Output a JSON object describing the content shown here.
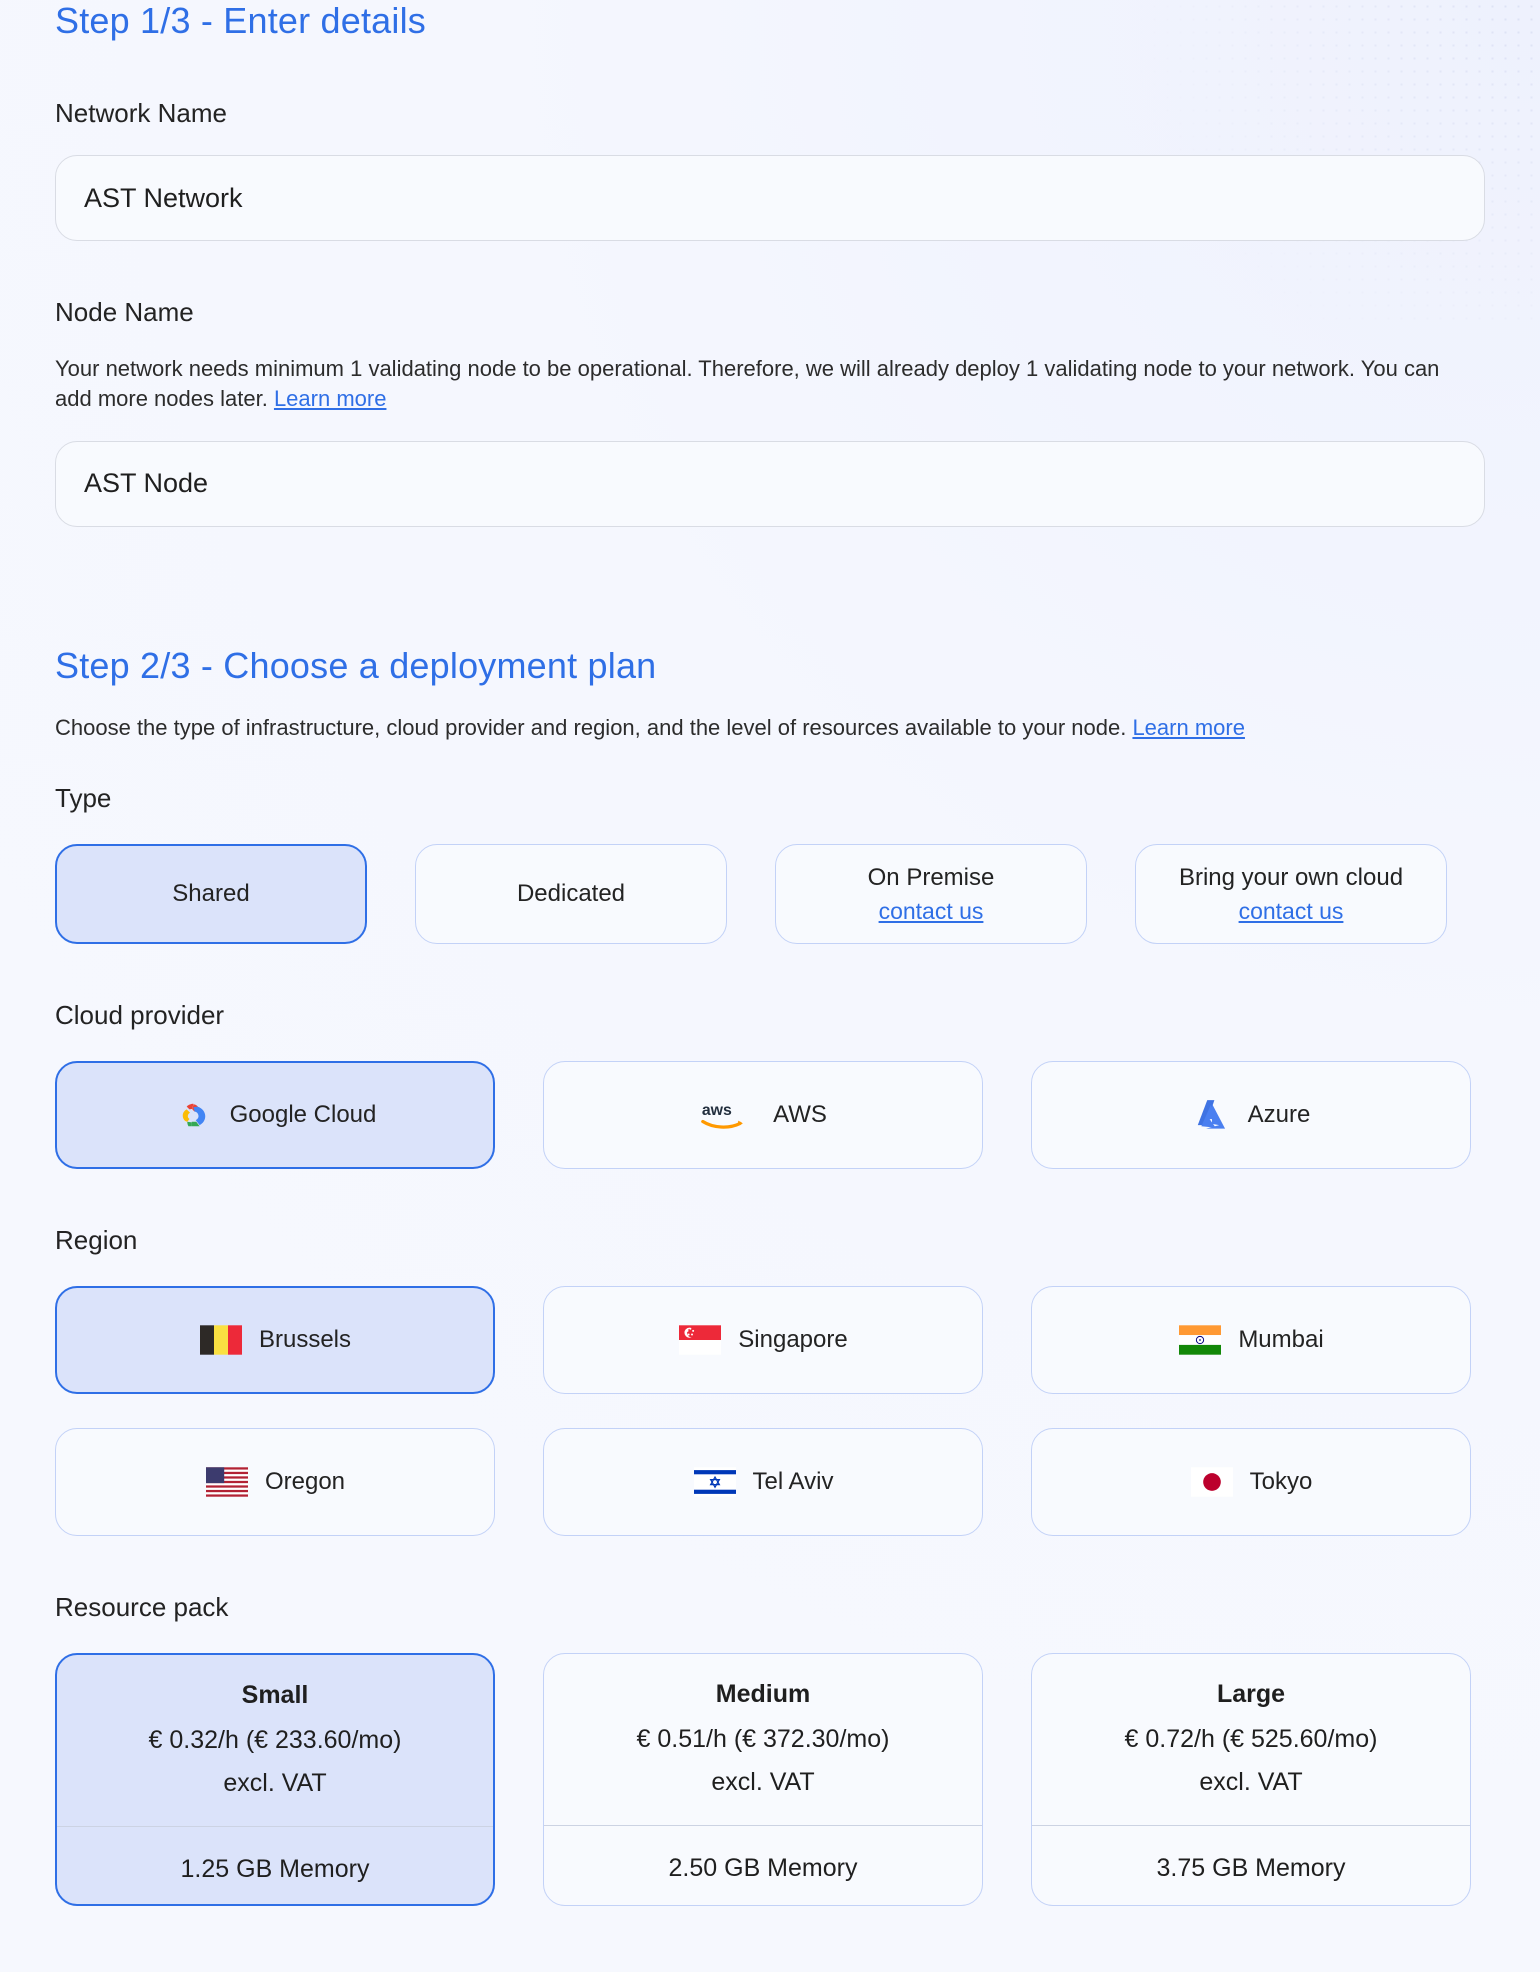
{
  "step1": {
    "title": "Step 1/3 - Enter details",
    "network_name_label": "Network Name",
    "network_name_value": "AST Network",
    "network_name_placeholder": "Network Name",
    "node_name_label": "Node Name",
    "node_helper": "Your network needs minimum 1 validating node to be operational. Therefore, we will already deploy 1 validating node to your network. You can add more nodes later.",
    "node_helper_link": "Learn more",
    "node_name_value": "AST Node",
    "node_name_placeholder": "Node Name"
  },
  "step2": {
    "title": "Step 2/3 - Choose a deployment plan",
    "description": "Choose the type of infrastructure, cloud provider and region, and the level of resources available to your node.",
    "description_link": "Learn more",
    "type_label": "Type",
    "types": [
      {
        "label": "Shared",
        "sub": "",
        "selected": true
      },
      {
        "label": "Dedicated",
        "sub": "",
        "selected": false
      },
      {
        "label": "On Premise",
        "sub": "contact us",
        "selected": false
      },
      {
        "label": "Bring your own cloud",
        "sub": "contact us",
        "selected": false
      }
    ],
    "cloud_provider_label": "Cloud provider",
    "providers": [
      {
        "label": "Google Cloud",
        "icon": "google-cloud-logo",
        "selected": true
      },
      {
        "label": "AWS",
        "icon": "aws-logo",
        "selected": false
      },
      {
        "label": "Azure",
        "icon": "azure-logo",
        "selected": false
      }
    ],
    "region_label": "Region",
    "regions": [
      {
        "label": "Brussels",
        "icon": "flag-belgium",
        "selected": true
      },
      {
        "label": "Singapore",
        "icon": "flag-singapore",
        "selected": false
      },
      {
        "label": "Mumbai",
        "icon": "flag-india",
        "selected": false
      },
      {
        "label": "Oregon",
        "icon": "flag-united-states",
        "selected": false
      },
      {
        "label": "Tel Aviv",
        "icon": "flag-israel",
        "selected": false
      },
      {
        "label": "Tokyo",
        "icon": "flag-japan",
        "selected": false
      }
    ],
    "resource_pack_label": "Resource pack",
    "packs": [
      {
        "name": "Small",
        "price": "€ 0.32/h (€ 233.60/mo)",
        "vat": "excl. VAT",
        "memory": "1.25 GB Memory",
        "selected": true
      },
      {
        "name": "Medium",
        "price": "€ 0.51/h (€ 372.30/mo)",
        "vat": "excl. VAT",
        "memory": "2.50 GB Memory",
        "selected": false
      },
      {
        "name": "Large",
        "price": "€ 0.72/h (€ 525.60/mo)",
        "vat": "excl. VAT",
        "memory": "3.75 GB Memory",
        "selected": false
      }
    ]
  },
  "colors": {
    "accent": "#2f6fe6",
    "selected_bg": "#dbe3fa",
    "page_bg": "#f4f6fd",
    "border": "#c3d2f7",
    "input_border": "#d9dce4"
  }
}
